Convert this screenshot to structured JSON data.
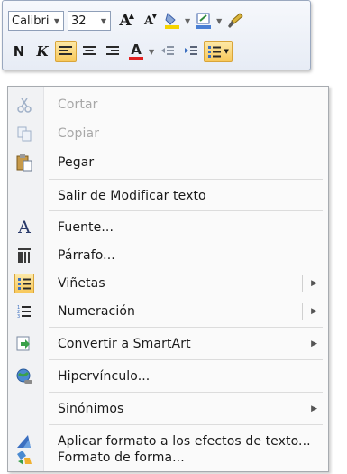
{
  "minibar": {
    "font_name": "Calibri (C",
    "font_size": "32",
    "grow_font": "A",
    "shrink_font": "A",
    "bold": "N",
    "italic": "K",
    "font_color_letter": "A"
  },
  "menu": {
    "items": [
      {
        "label": "Cortar",
        "icon": "scissors-icon",
        "disabled": true
      },
      {
        "label": "Copiar",
        "icon": "copy-icon",
        "disabled": true
      },
      {
        "label": "Pegar",
        "icon": "paste-icon",
        "disabled": false
      },
      {
        "label": "Salir de Modificar texto",
        "icon": "",
        "disabled": false
      },
      {
        "label": "Fuente...",
        "icon": "font-icon",
        "disabled": false
      },
      {
        "label": "Párrafo...",
        "icon": "paragraph-icon",
        "disabled": false
      },
      {
        "label": "Viñetas",
        "icon": "bullets-icon",
        "disabled": false,
        "submenu": true
      },
      {
        "label": "Numeración",
        "icon": "numbering-icon",
        "disabled": false,
        "submenu": true
      },
      {
        "label": "Convertir a SmartArt",
        "icon": "smartart-icon",
        "disabled": false,
        "submenu": true
      },
      {
        "label": "Hipervínculo...",
        "icon": "hyperlink-icon",
        "disabled": false
      },
      {
        "label": "Sinónimos",
        "icon": "",
        "disabled": false,
        "submenu": true
      },
      {
        "label": "Aplicar formato a los efectos de texto...",
        "icon": "text-effects-icon",
        "disabled": false
      },
      {
        "label": "Formato de forma...",
        "icon": "format-shape-icon",
        "disabled": false
      }
    ]
  },
  "colors": {
    "highlight_yellow": "#f8c85a",
    "font_color_red": "#e02020",
    "highlight_marker": "#f5d300",
    "menu_disabled_text": "#a8a8a8"
  }
}
